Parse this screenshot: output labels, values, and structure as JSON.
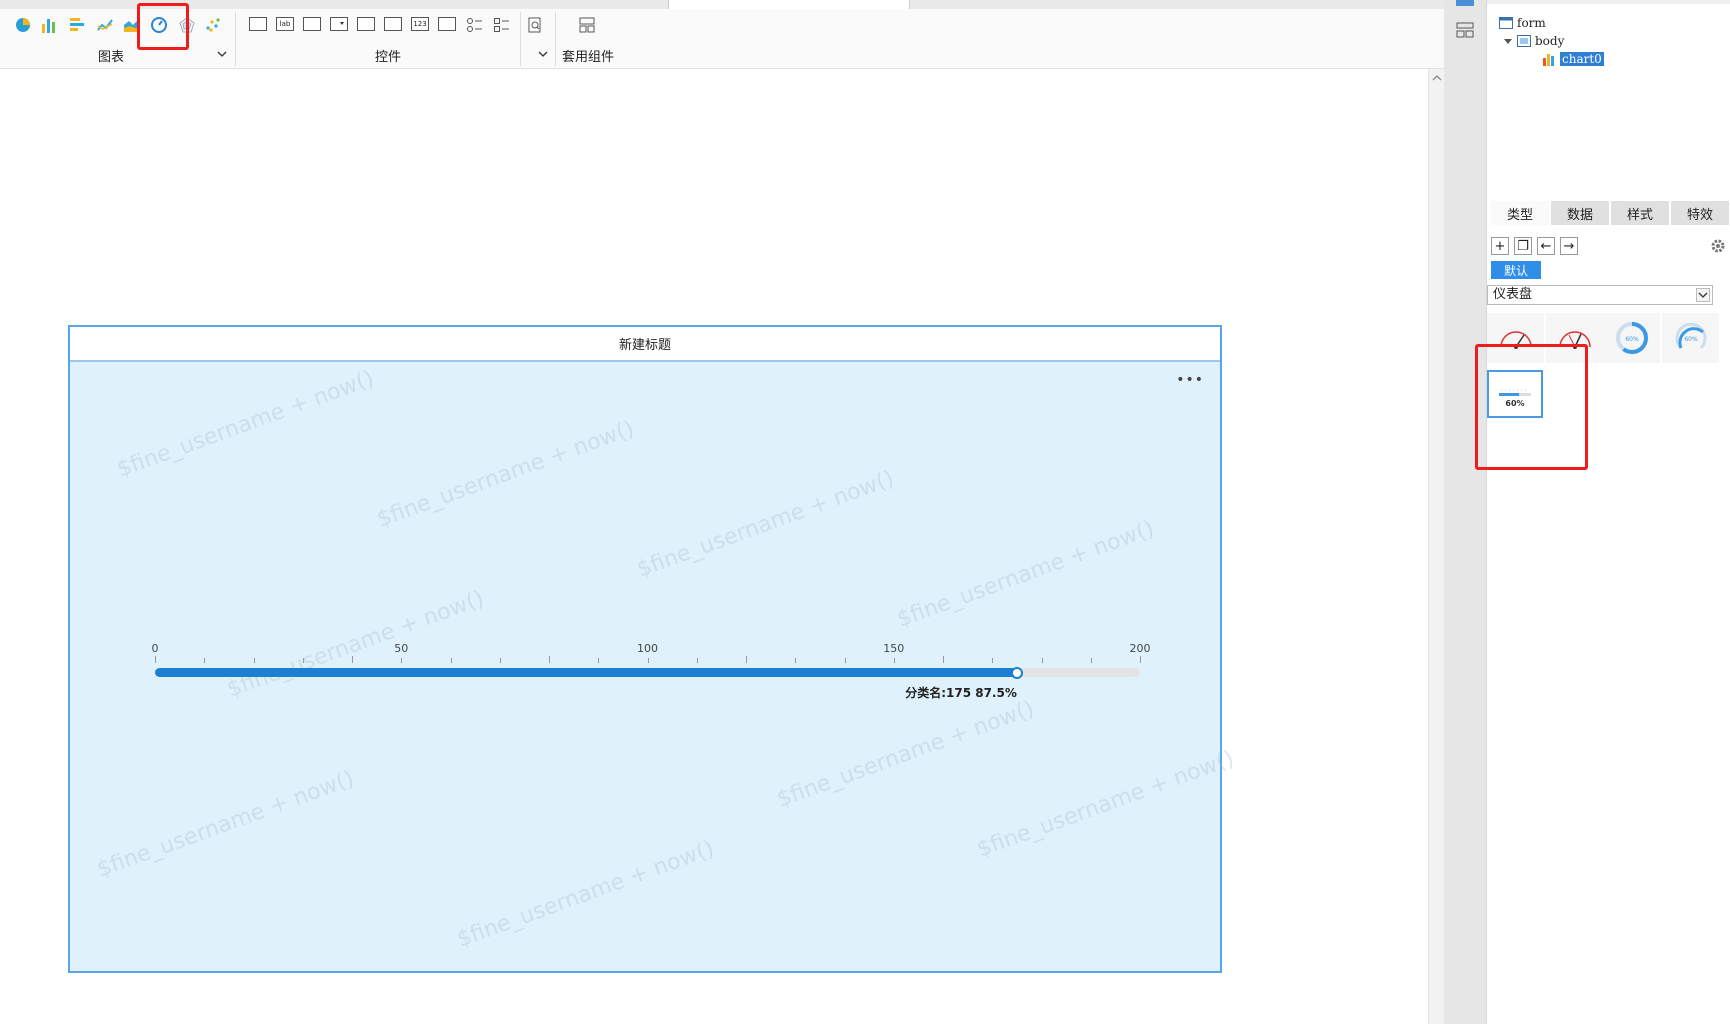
{
  "toolbar": {
    "chart_group_label": "图表",
    "control_group_label": "控件",
    "widget_group_label": "套用组件",
    "chart_icons": [
      "pie-chart-icon",
      "bar-chart-icon",
      "horizontal-bar-icon",
      "line-chart-icon",
      "area-chart-icon",
      "gauge-chart-icon",
      "radar-chart-icon",
      "scatter-chart-icon"
    ],
    "control_icons": [
      "textbox-icon",
      "label-icon",
      "button-icon",
      "combo-box-icon",
      "date-picker-icon",
      "calendar-icon",
      "number-input-icon",
      "textarea-icon",
      "radio-group-icon",
      "checkbox-group-icon",
      "search-icon"
    ],
    "colors": {
      "pie": "#2a9fd6",
      "bar_a": "#f2b61c",
      "bar_b": "#2ea8e3",
      "gauge": "#2a86d6"
    }
  },
  "widget": {
    "title": "新建标题",
    "more_label": "•••",
    "watermark": "$fine_username + now()",
    "background": "#dff2fc"
  },
  "gauge": {
    "ticks": [
      "0",
      "50",
      "100",
      "150",
      "200"
    ],
    "min": 0,
    "max": 200,
    "value": 175,
    "label": "分类名:175 87.5%",
    "bar_color": "#1d7fd1",
    "track_color": "#e3e3e3"
  },
  "tree": {
    "form": "form",
    "body": "body",
    "chart": "chart0"
  },
  "panel": {
    "tabs": [
      "类型",
      "数据",
      "样式",
      "特效"
    ],
    "buttons": [
      "+",
      "❐",
      "←",
      "→"
    ],
    "default_tag": "默认",
    "chart_type": "仪表盘",
    "thumb_pct": "60%"
  }
}
